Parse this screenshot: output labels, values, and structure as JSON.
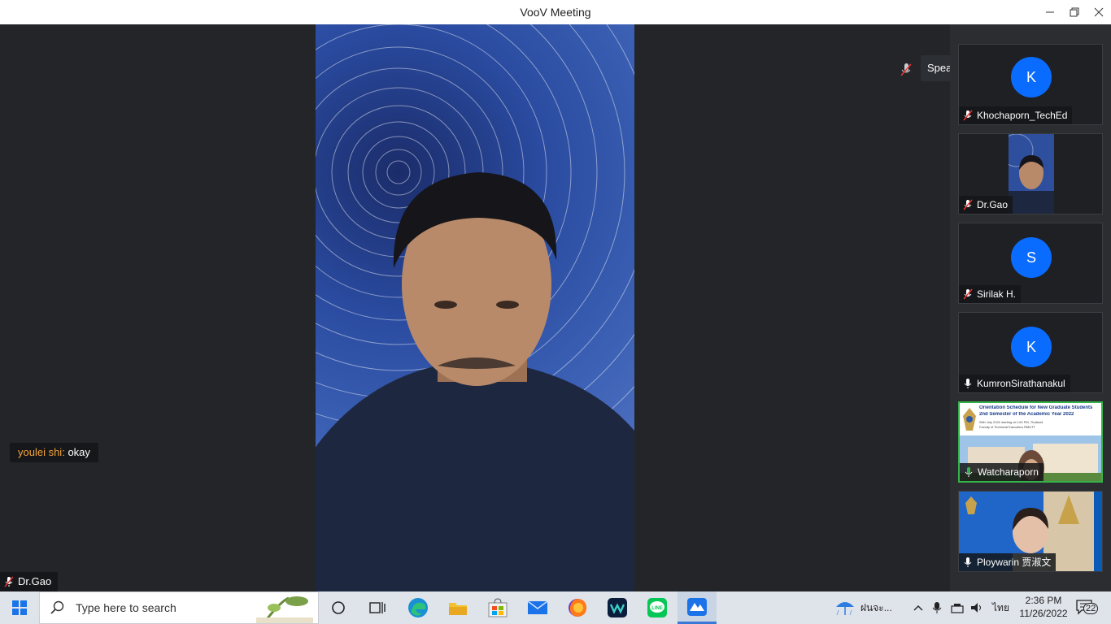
{
  "window": {
    "title": "VooV Meeting"
  },
  "chat": {
    "sender": "youlei shi:",
    "message": "okay"
  },
  "main_video": {
    "participant": "Dr.Gao"
  },
  "speaking": {
    "label": "Speaking: Watcharaporn;"
  },
  "participants": [
    {
      "name": "Khochaporn_TechEd",
      "initial": "K",
      "muted": true,
      "type": "avatar"
    },
    {
      "name": "Dr.Gao",
      "muted": true,
      "type": "video"
    },
    {
      "name": "Sirilak H.",
      "initial": "S",
      "muted": true,
      "type": "avatar"
    },
    {
      "name": "KumronSirathanakul",
      "initial": "K",
      "muted": false,
      "type": "avatar"
    },
    {
      "name": "Watcharaporn",
      "muted": false,
      "type": "slide",
      "active": true,
      "slide_title": "Orientation Schedule for New Graduate Students",
      "slide_subtitle": "2nd Semester of the Academic Year 2022",
      "slide_line1": "26th July 2022 starting at 1:00 PM, Thailand",
      "slide_line2": "Faculty of Technical Education RMUTT"
    },
    {
      "name": "Ploywarin 贾淑文",
      "muted": false,
      "type": "video2"
    }
  ],
  "taskbar": {
    "search_placeholder": "Type here to search",
    "weather_text": "ฝนจะ...",
    "language": "ไทย",
    "time": "2:36 PM",
    "date": "11/26/2022",
    "notification_count": "22",
    "apps": [
      "task-view",
      "edge",
      "file-explorer",
      "microsoft-store",
      "mail",
      "firefox",
      "webex",
      "line",
      "voov-meeting"
    ]
  },
  "colors": {
    "avatar_blue": "#0a6cff",
    "active_border": "#36b24a",
    "chat_sender": "#f5a33a"
  }
}
